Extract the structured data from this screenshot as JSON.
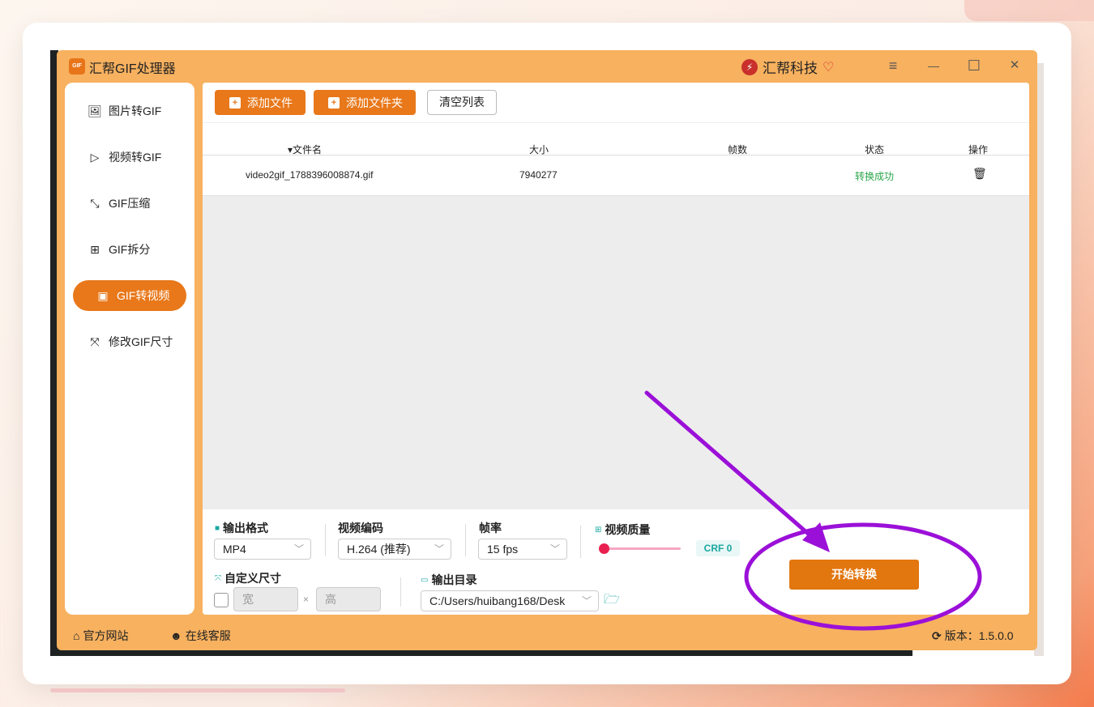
{
  "app": {
    "title": "汇帮GIF处理器",
    "logo_text": "GIF",
    "brand": "汇帮科技"
  },
  "window_controls": {
    "menu": "≡",
    "minimize": "—",
    "maximize": "☐",
    "close": "✕"
  },
  "sidebar": {
    "items": [
      {
        "label": "图片转GIF",
        "icon": "image-icon"
      },
      {
        "label": "视频转GIF",
        "icon": "play-circle-icon"
      },
      {
        "label": "GIF压缩",
        "icon": "compress-icon"
      },
      {
        "label": "GIF拆分",
        "icon": "split-icon"
      },
      {
        "label": "GIF转视频",
        "icon": "video-camera-icon",
        "active": true
      },
      {
        "label": "修改GIF尺寸",
        "icon": "resize-icon"
      }
    ]
  },
  "toolbar": {
    "add_file": "添加文件",
    "add_folder": "添加文件夹",
    "clear_list": "清空列表"
  },
  "table": {
    "headers": [
      "▾文件名",
      "大小",
      "帧数",
      "状态",
      "操作"
    ],
    "rows": [
      {
        "filename": "video2gif_1788396008874.gif",
        "size": "7940277",
        "frames": "",
        "status": "转换成功"
      }
    ]
  },
  "settings": {
    "output_format_label": "输出格式",
    "output_format_value": "MP4",
    "video_codec_label": "视频编码",
    "video_codec_value": "H.264 (推荐)",
    "frame_rate_label": "帧率",
    "frame_rate_value": "15 fps",
    "quality_label": "视频质量",
    "quality_value": "CRF 0",
    "quality_level": 0,
    "custom_size_label": "自定义尺寸",
    "width_placeholder": "宽",
    "height_placeholder": "高",
    "times": "×",
    "output_dir_label": "输出目录",
    "output_dir_value": "C:/Users/huibang168/Desk",
    "start_button": "开始转换"
  },
  "footer": {
    "website": "官方网站",
    "support": "在线客服",
    "version": "版本：1.5.0.0"
  },
  "colors": {
    "accent": "#e8781a",
    "frame": "#f7b15f",
    "success": "#2aa64a",
    "annotation": "#9b10d8"
  }
}
